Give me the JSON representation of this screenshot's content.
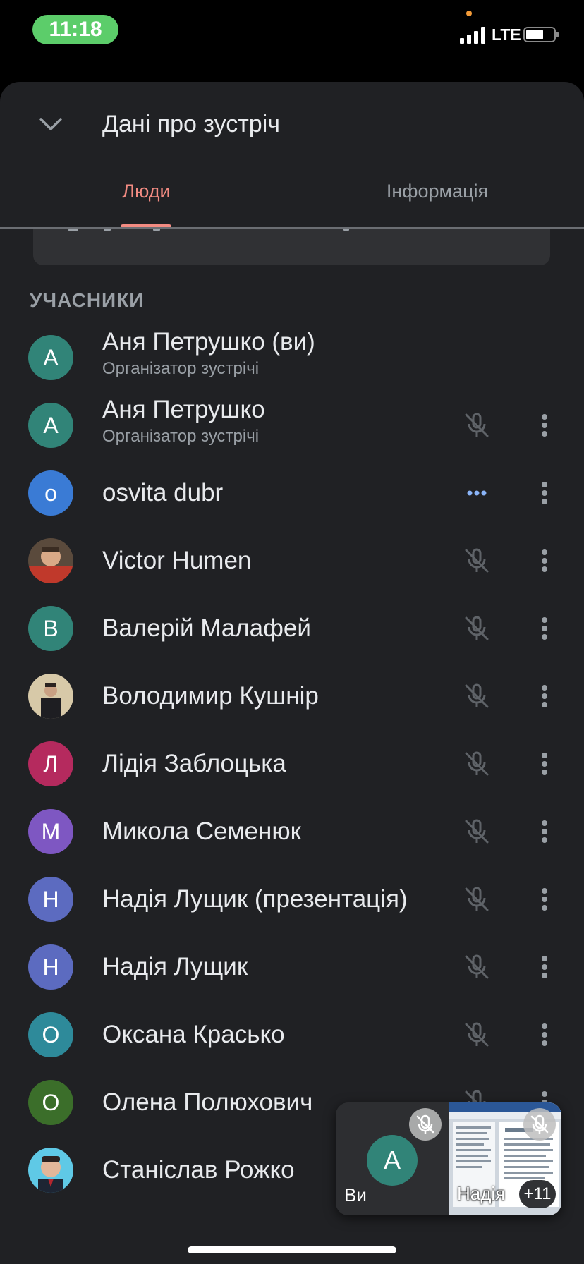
{
  "status_bar": {
    "time": "11:18",
    "network": "LTE"
  },
  "sheet": {
    "title": "Дані про зустріч",
    "tabs": [
      {
        "label": "Люди",
        "active": true
      },
      {
        "label": "Інформація",
        "active": false
      }
    ]
  },
  "section_label": "УЧАСНИКИ",
  "participants": [
    {
      "initial": "А",
      "name": "Аня Петрушко (ви)",
      "role": "Організатор зустрічі",
      "avatar_color": "#318478",
      "mic": "none",
      "menu": false
    },
    {
      "initial": "А",
      "name": "Аня Петрушко",
      "role": "Організатор зустрічі",
      "avatar_color": "#318478",
      "mic": "muted",
      "menu": true
    },
    {
      "initial": "o",
      "name": "osvita dubr",
      "role": "",
      "avatar_color": "#3a7bd5",
      "mic": "speaking",
      "menu": true
    },
    {
      "initial": "",
      "name": "Victor Humen",
      "role": "",
      "avatar_color": "photo",
      "mic": "muted",
      "menu": true
    },
    {
      "initial": "В",
      "name": "Валерій Малафей",
      "role": "",
      "avatar_color": "#318478",
      "mic": "muted",
      "menu": true
    },
    {
      "initial": "",
      "name": "Володимир Кушнір",
      "role": "",
      "avatar_color": "photo",
      "mic": "muted",
      "menu": true
    },
    {
      "initial": "Л",
      "name": "Лідія Заблоцька",
      "role": "",
      "avatar_color": "#b52a5e",
      "mic": "muted",
      "menu": true
    },
    {
      "initial": "М",
      "name": "Микола Семенюк",
      "role": "",
      "avatar_color": "#7e57c2",
      "mic": "muted",
      "menu": true
    },
    {
      "initial": "Н",
      "name": "Надія Лущик (презентація)",
      "role": "",
      "avatar_color": "#5c6bc0",
      "mic": "muted",
      "menu": true
    },
    {
      "initial": "Н",
      "name": "Надія Лущик",
      "role": "",
      "avatar_color": "#5c6bc0",
      "mic": "muted",
      "menu": true
    },
    {
      "initial": "О",
      "name": "Оксана Красько",
      "role": "",
      "avatar_color": "#2e8a9a",
      "mic": "muted",
      "menu": true
    },
    {
      "initial": "О",
      "name": "Олена Полюхович",
      "role": "",
      "avatar_color": "#3b6e2a",
      "mic": "muted",
      "menu": true
    },
    {
      "initial": "",
      "name": "Станіслав Рожко",
      "role": "",
      "avatar_color": "photo",
      "mic": "muted",
      "menu": true
    }
  ],
  "pip": {
    "self_initial": "A",
    "self_label": "Ви",
    "other_label": "Надія",
    "extra_count": "+11"
  },
  "colors": {
    "background": "#202124",
    "accent": "#f28b82",
    "speaking": "#8ab4f8"
  },
  "icons": [
    "chevron-down-icon",
    "mic-off-icon",
    "more-vert-icon",
    "speaking-dots-icon"
  ]
}
